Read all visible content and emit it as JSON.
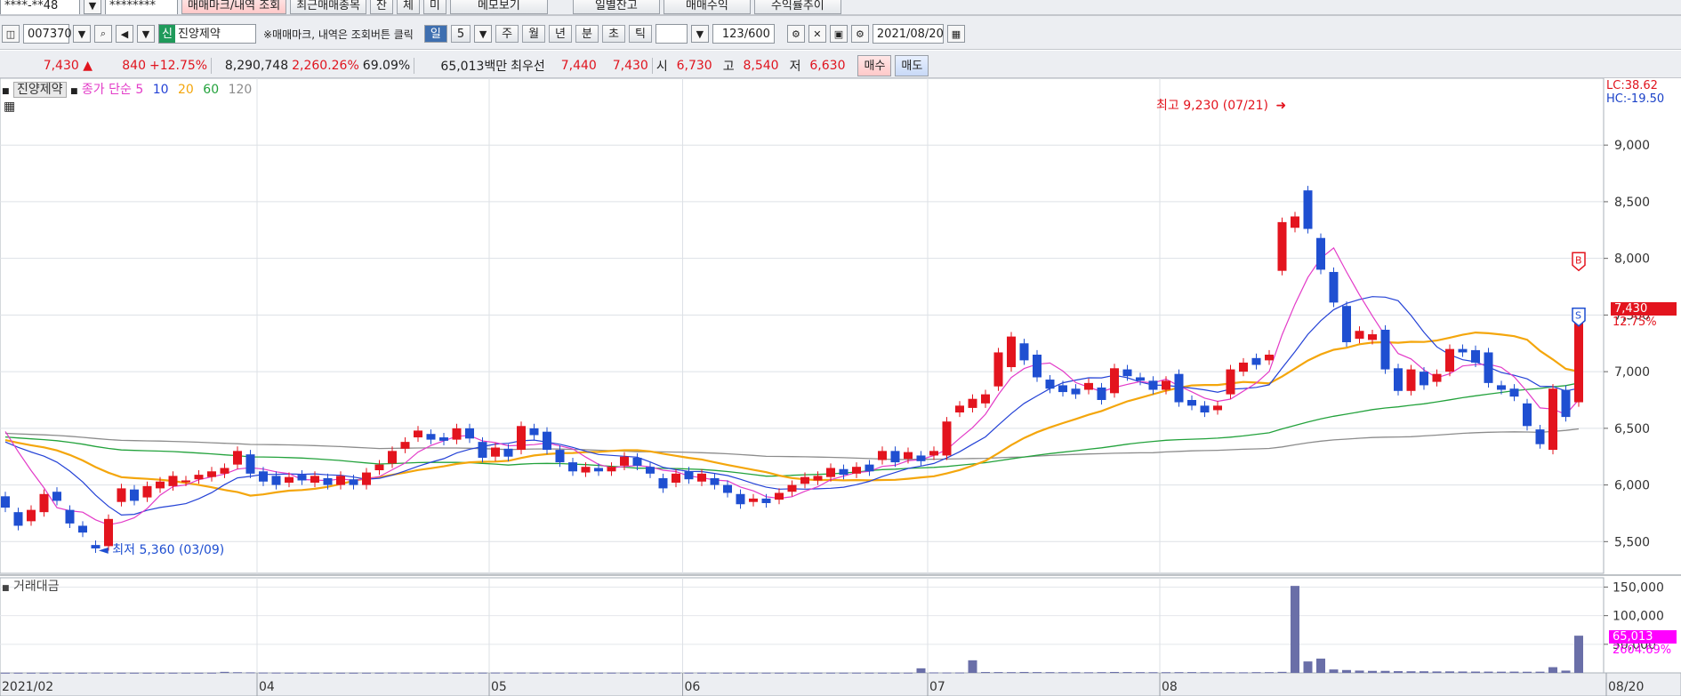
{
  "toolbar1": {
    "account": "****-**48",
    "password": "********",
    "buttons": [
      "매매마크/내역 조회",
      "최근매매종목",
      "잔",
      "체",
      "미",
      "메모보기",
      "일별잔고",
      "매매수익",
      "수익률추이"
    ]
  },
  "toolbar2": {
    "code": "007370",
    "badge": "신",
    "name": "진양제약",
    "hint": "※매매마크, 내역은 조회버튼 클릭",
    "periods": [
      "일",
      "5",
      "주",
      "월",
      "년",
      "분",
      "초",
      "틱"
    ],
    "count": "123",
    "count_max": "/600",
    "date": "2021/08/20"
  },
  "quote": {
    "price": "7,430 ▲",
    "change": "840",
    "change_pct": "+12.75%",
    "volume": "8,290,748",
    "volume_pct": "2,260.26%",
    "ratio": "69.09%",
    "amount": "65,013백만",
    "best_label": "최우선",
    "ask": "7,440",
    "bid": "7,430",
    "open_label": "시",
    "open": "6,730",
    "high_label": "고",
    "high": "8,540",
    "low_label": "저",
    "low": "6,630",
    "buy_label": "매수",
    "sell_label": "매도"
  },
  "legend": {
    "stock": "진양제약",
    "ma_label": "종가 단순",
    "periods": [
      "5",
      "10",
      "20",
      "60",
      "120"
    ],
    "volume_title": "거래대금"
  },
  "colors": {
    "up": "#e3141e",
    "down": "#1f4fd1",
    "ma5": "#e33bc8",
    "ma10": "#2442d6",
    "ma20": "#f4a60c",
    "ma60": "#23a23c",
    "ma120": "#8c8c8c",
    "volume": "#6a6fa8"
  },
  "annotations": {
    "max": "최고 9,230 (07/21)",
    "min": "최저 5,360 (03/09)",
    "lc": "LC:38.62",
    "hc": "HC:-19.50",
    "last_price": "7,430",
    "last_pct": "12.75%",
    "vol_last": "65,013",
    "vol_pct": "2604.69%",
    "buy_mark": "B",
    "sell_mark": "S"
  },
  "chart_data": {
    "type": "candlestick",
    "y_ticks": [
      "9,000",
      "8,500",
      "8,000",
      "7,500",
      "7,000",
      "6,500",
      "6,000",
      "5,500"
    ],
    "ylim": [
      5220,
      9590
    ],
    "volume_ticks": [
      "150,000",
      "100,000",
      "50,000"
    ],
    "volume_ylim": [
      0,
      160000
    ],
    "x_labels": [
      "2021/02",
      "04",
      "05",
      "06",
      "07",
      "08",
      "08/20"
    ],
    "candles": [
      {
        "o": 5900,
        "c": 5800
      },
      {
        "o": 5760,
        "c": 5640
      },
      {
        "o": 5680,
        "c": 5780
      },
      {
        "o": 5760,
        "c": 5920
      },
      {
        "o": 5940,
        "c": 5860
      },
      {
        "o": 5780,
        "c": 5660
      },
      {
        "o": 5640,
        "c": 5580
      },
      {
        "o": 5470,
        "c": 5440
      },
      {
        "o": 5460,
        "c": 5700
      },
      {
        "o": 5850,
        "c": 5970
      },
      {
        "o": 5960,
        "c": 5860
      },
      {
        "o": 5890,
        "c": 5990
      },
      {
        "o": 5970,
        "c": 6030
      },
      {
        "o": 5990,
        "c": 6080
      },
      {
        "o": 6030,
        "c": 6040
      },
      {
        "o": 6050,
        "c": 6090
      },
      {
        "o": 6070,
        "c": 6120
      },
      {
        "o": 6100,
        "c": 6150
      },
      {
        "o": 6180,
        "c": 6300
      },
      {
        "o": 6270,
        "c": 6100
      },
      {
        "o": 6120,
        "c": 6030
      },
      {
        "o": 6080,
        "c": 6000
      },
      {
        "o": 6020,
        "c": 6070
      },
      {
        "o": 6090,
        "c": 6040
      },
      {
        "o": 6020,
        "c": 6080
      },
      {
        "o": 6060,
        "c": 6000
      },
      {
        "o": 6000,
        "c": 6080
      },
      {
        "o": 6050,
        "c": 6000
      },
      {
        "o": 6000,
        "c": 6110
      },
      {
        "o": 6130,
        "c": 6180
      },
      {
        "o": 6190,
        "c": 6300
      },
      {
        "o": 6320,
        "c": 6380
      },
      {
        "o": 6420,
        "c": 6480
      },
      {
        "o": 6450,
        "c": 6400
      },
      {
        "o": 6420,
        "c": 6390
      },
      {
        "o": 6400,
        "c": 6500
      },
      {
        "o": 6500,
        "c": 6410
      },
      {
        "o": 6380,
        "c": 6240
      },
      {
        "o": 6250,
        "c": 6330
      },
      {
        "o": 6320,
        "c": 6250
      },
      {
        "o": 6310,
        "c": 6520
      },
      {
        "o": 6500,
        "c": 6440
      },
      {
        "o": 6470,
        "c": 6310
      },
      {
        "o": 6310,
        "c": 6200
      },
      {
        "o": 6200,
        "c": 6120
      },
      {
        "o": 6110,
        "c": 6160
      },
      {
        "o": 6150,
        "c": 6120
      },
      {
        "o": 6120,
        "c": 6160
      },
      {
        "o": 6170,
        "c": 6250
      },
      {
        "o": 6240,
        "c": 6170
      },
      {
        "o": 6160,
        "c": 6100
      },
      {
        "o": 6060,
        "c": 5970
      },
      {
        "o": 6020,
        "c": 6100
      },
      {
        "o": 6120,
        "c": 6050
      },
      {
        "o": 6030,
        "c": 6100
      },
      {
        "o": 6060,
        "c": 6000
      },
      {
        "o": 6000,
        "c": 5930
      },
      {
        "o": 5920,
        "c": 5830
      },
      {
        "o": 5850,
        "c": 5880
      },
      {
        "o": 5880,
        "c": 5840
      },
      {
        "o": 5870,
        "c": 5930
      },
      {
        "o": 5940,
        "c": 6000
      },
      {
        "o": 6010,
        "c": 6070
      },
      {
        "o": 6040,
        "c": 6080
      },
      {
        "o": 6070,
        "c": 6150
      },
      {
        "o": 6140,
        "c": 6090
      },
      {
        "o": 6100,
        "c": 6160
      },
      {
        "o": 6180,
        "c": 6120
      },
      {
        "o": 6220,
        "c": 6300
      },
      {
        "o": 6300,
        "c": 6200
      },
      {
        "o": 6230,
        "c": 6290
      },
      {
        "o": 6260,
        "c": 6210
      },
      {
        "o": 6260,
        "c": 6300
      },
      {
        "o": 6260,
        "c": 6560
      },
      {
        "o": 6640,
        "c": 6700
      },
      {
        "o": 6680,
        "c": 6760
      },
      {
        "o": 6720,
        "c": 6800
      },
      {
        "o": 6870,
        "c": 7170
      },
      {
        "o": 7040,
        "c": 7310
      },
      {
        "o": 7250,
        "c": 7100
      },
      {
        "o": 7150,
        "c": 6950
      },
      {
        "o": 6930,
        "c": 6850
      },
      {
        "o": 6880,
        "c": 6820
      },
      {
        "o": 6850,
        "c": 6800
      },
      {
        "o": 6840,
        "c": 6900
      },
      {
        "o": 6860,
        "c": 6750
      },
      {
        "o": 6810,
        "c": 7030
      },
      {
        "o": 7020,
        "c": 6960
      },
      {
        "o": 6950,
        "c": 6920
      },
      {
        "o": 6920,
        "c": 6840
      },
      {
        "o": 6840,
        "c": 6920
      },
      {
        "o": 6980,
        "c": 6730
      },
      {
        "o": 6750,
        "c": 6700
      },
      {
        "o": 6700,
        "c": 6640
      },
      {
        "o": 6660,
        "c": 6700
      },
      {
        "o": 6800,
        "c": 7020
      },
      {
        "o": 7000,
        "c": 7080
      },
      {
        "o": 7120,
        "c": 7060
      },
      {
        "o": 7100,
        "c": 7150
      },
      {
        "o": 7890,
        "c": 8320
      },
      {
        "o": 8270,
        "c": 8370
      },
      {
        "o": 8600,
        "c": 8260
      },
      {
        "o": 8180,
        "c": 7900
      },
      {
        "o": 7880,
        "c": 7610
      },
      {
        "o": 7580,
        "c": 7260
      },
      {
        "o": 7290,
        "c": 7360
      },
      {
        "o": 7280,
        "c": 7330
      },
      {
        "o": 7370,
        "c": 7020
      },
      {
        "o": 7030,
        "c": 6830
      },
      {
        "o": 6830,
        "c": 7020
      },
      {
        "o": 7000,
        "c": 6880
      },
      {
        "o": 6910,
        "c": 6980
      },
      {
        "o": 7000,
        "c": 7200
      },
      {
        "o": 7200,
        "c": 7170
      },
      {
        "o": 7190,
        "c": 7080
      },
      {
        "o": 7170,
        "c": 6900
      },
      {
        "o": 6880,
        "c": 6840
      },
      {
        "o": 6850,
        "c": 6780
      },
      {
        "o": 6720,
        "c": 6520
      },
      {
        "o": 6490,
        "c": 6360
      },
      {
        "o": 6310,
        "c": 6850
      },
      {
        "o": 6840,
        "c": 6600
      },
      {
        "o": 6730,
        "c": 7430
      }
    ],
    "volumes_millions": [
      320,
      310,
      300,
      320,
      340,
      300,
      300,
      500,
      300,
      300,
      300,
      310,
      300,
      310,
      320,
      300,
      350,
      1800,
      1200,
      900,
      600,
      500,
      400,
      400,
      380,
      360,
      340,
      320,
      330,
      380,
      520,
      500,
      480,
      460,
      420,
      440,
      430,
      470,
      600,
      500,
      560,
      480,
      420,
      420,
      420,
      400,
      400,
      420,
      440,
      400,
      380,
      430,
      400,
      420,
      400,
      380,
      360,
      370,
      360,
      380,
      360,
      380,
      400,
      380,
      400,
      380,
      400,
      420,
      400,
      380,
      420,
      8000,
      800,
      700,
      700,
      22000,
      1500,
      1400,
      1300,
      1600,
      1400,
      1300,
      1200,
      1200,
      1100,
      1300,
      1600,
      1400,
      1300,
      1200,
      1200,
      1300,
      1400,
      1200,
      1100,
      1100,
      1000,
      1300,
      1300,
      1800,
      152000,
      20000,
      25000,
      6000,
      5000,
      4000,
      3500,
      3500,
      3000,
      2800,
      2800,
      2500,
      2600,
      2400,
      2300,
      2200,
      2100,
      2200,
      2000,
      2100,
      10000,
      4000,
      65013
    ]
  }
}
